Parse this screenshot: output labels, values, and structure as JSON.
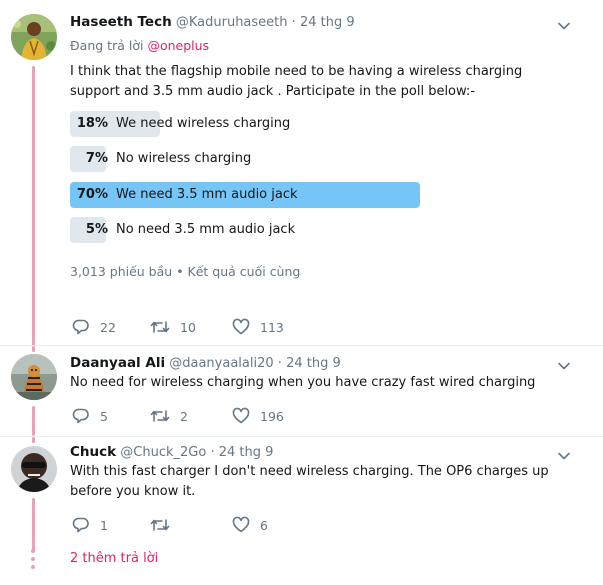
{
  "tweets": [
    {
      "name": "Haseeth Tech",
      "handle": "@Kaduruhaseeth",
      "separator": "·",
      "date": "24 thg 9",
      "reply_prefix": "Đang trả lời",
      "reply_mention": "@oneplus",
      "text": "I think that the flagship mobile need to be having a wireless charging support and 3.5 mm audio jack . Participate in the poll below:-",
      "poll": {
        "options": [
          {
            "percent_label": "18%",
            "percent": 18,
            "label": "We need wireless charging",
            "winner": false
          },
          {
            "percent_label": "7%",
            "percent": 7,
            "label": "No wireless charging",
            "winner": false
          },
          {
            "percent_label": "70%",
            "percent": 70,
            "label": "We need 3.5 mm audio jack",
            "winner": true
          },
          {
            "percent_label": "5%",
            "percent": 5,
            "label": "No need 3.5 mm audio jack",
            "winner": false
          }
        ],
        "votes": "3,013 phiếu bầu",
        "separator": "•",
        "status": "Kết quả cuối cùng"
      },
      "actions": {
        "replies": "22",
        "retweets": "10",
        "likes": "113"
      }
    },
    {
      "name": "Daanyaal Ali",
      "handle": "@daanyaalali20",
      "separator": "·",
      "date": "24 thg 9",
      "text": "No need for wireless charging when you have crazy fast wired charging",
      "actions": {
        "replies": "5",
        "retweets": "2",
        "likes": "196"
      }
    },
    {
      "name": "Chuck",
      "handle": "@Chuck_2Go",
      "separator": "·",
      "date": "24 thg 9",
      "text": "With this fast charger I don't need wireless charging. The OP6 charges up before you know it.",
      "actions": {
        "replies": "1",
        "retweets": "",
        "likes": "6"
      }
    }
  ],
  "more_replies": "2 thêm trả lời",
  "colors": {
    "accent": "#e0245e",
    "thread_line": "#e8a2b4",
    "poll_winner": "#75c6f6",
    "poll_bar": "#e1e8ed",
    "secondary_text": "#657786"
  },
  "icons": [
    "chevron-down-icon",
    "reply-icon",
    "retweet-icon",
    "like-icon"
  ]
}
